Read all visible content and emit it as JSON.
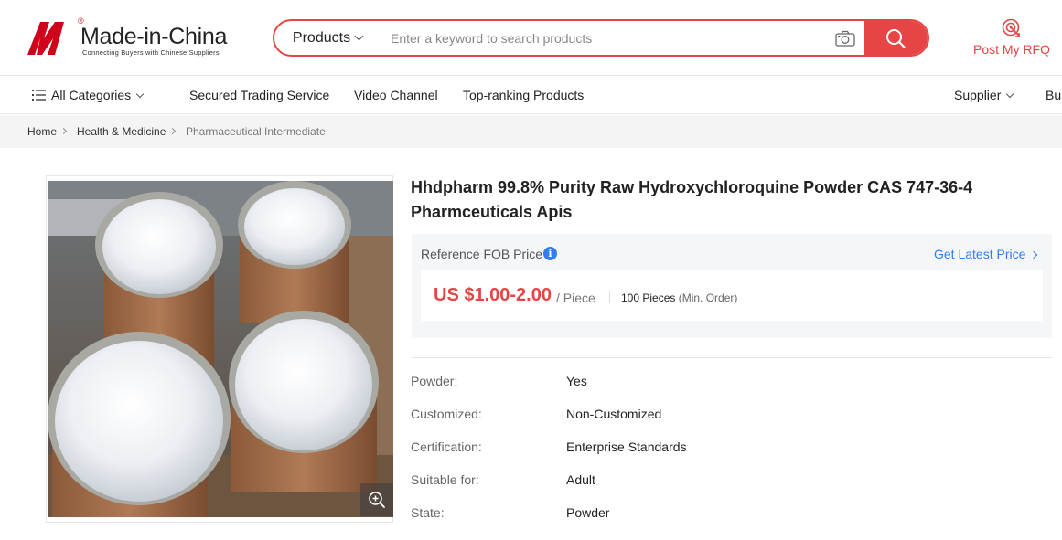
{
  "brand": {
    "name": "Made-in-China",
    "registered": "®",
    "tagline": "Connecting Buyers with Chinese Suppliers",
    "accent_color": "#e64545"
  },
  "search": {
    "category": "Products",
    "placeholder": "Enter a keyword to search products"
  },
  "rfq": {
    "label": "Post My RFQ"
  },
  "nav": {
    "all_categories": "All Categories",
    "items": [
      "Secured Trading Service",
      "Video Channel",
      "Top-ranking Products"
    ],
    "supplier": "Supplier",
    "buyer_truncated": "Bu"
  },
  "breadcrumb": [
    "Home",
    "Health & Medicine",
    "Pharmaceutical Intermediate"
  ],
  "product": {
    "title": "Hhdpharm 99.8% Purity Raw Hydroxychloroquine Powder CAS 747-36-4 Pharmceuticals Apis",
    "price_label": "Reference FOB Price",
    "latest_price_link": "Get Latest Price",
    "price": "US $1.00-2.00",
    "unit": "/ Piece",
    "moq_value": "100 Pieces",
    "moq_label": "(Min. Order)",
    "attributes": [
      {
        "key": "Powder:",
        "value": "Yes"
      },
      {
        "key": "Customized:",
        "value": "Non-Customized"
      },
      {
        "key": "Certification:",
        "value": "Enterprise Standards"
      },
      {
        "key": "Suitable for:",
        "value": "Adult"
      },
      {
        "key": "State:",
        "value": "Powder"
      }
    ]
  },
  "icons": {
    "menu": "menu-icon",
    "camera": "camera-icon",
    "search": "search-icon",
    "rfq": "target-icon",
    "info": "info-icon",
    "zoom": "zoom-icon"
  }
}
